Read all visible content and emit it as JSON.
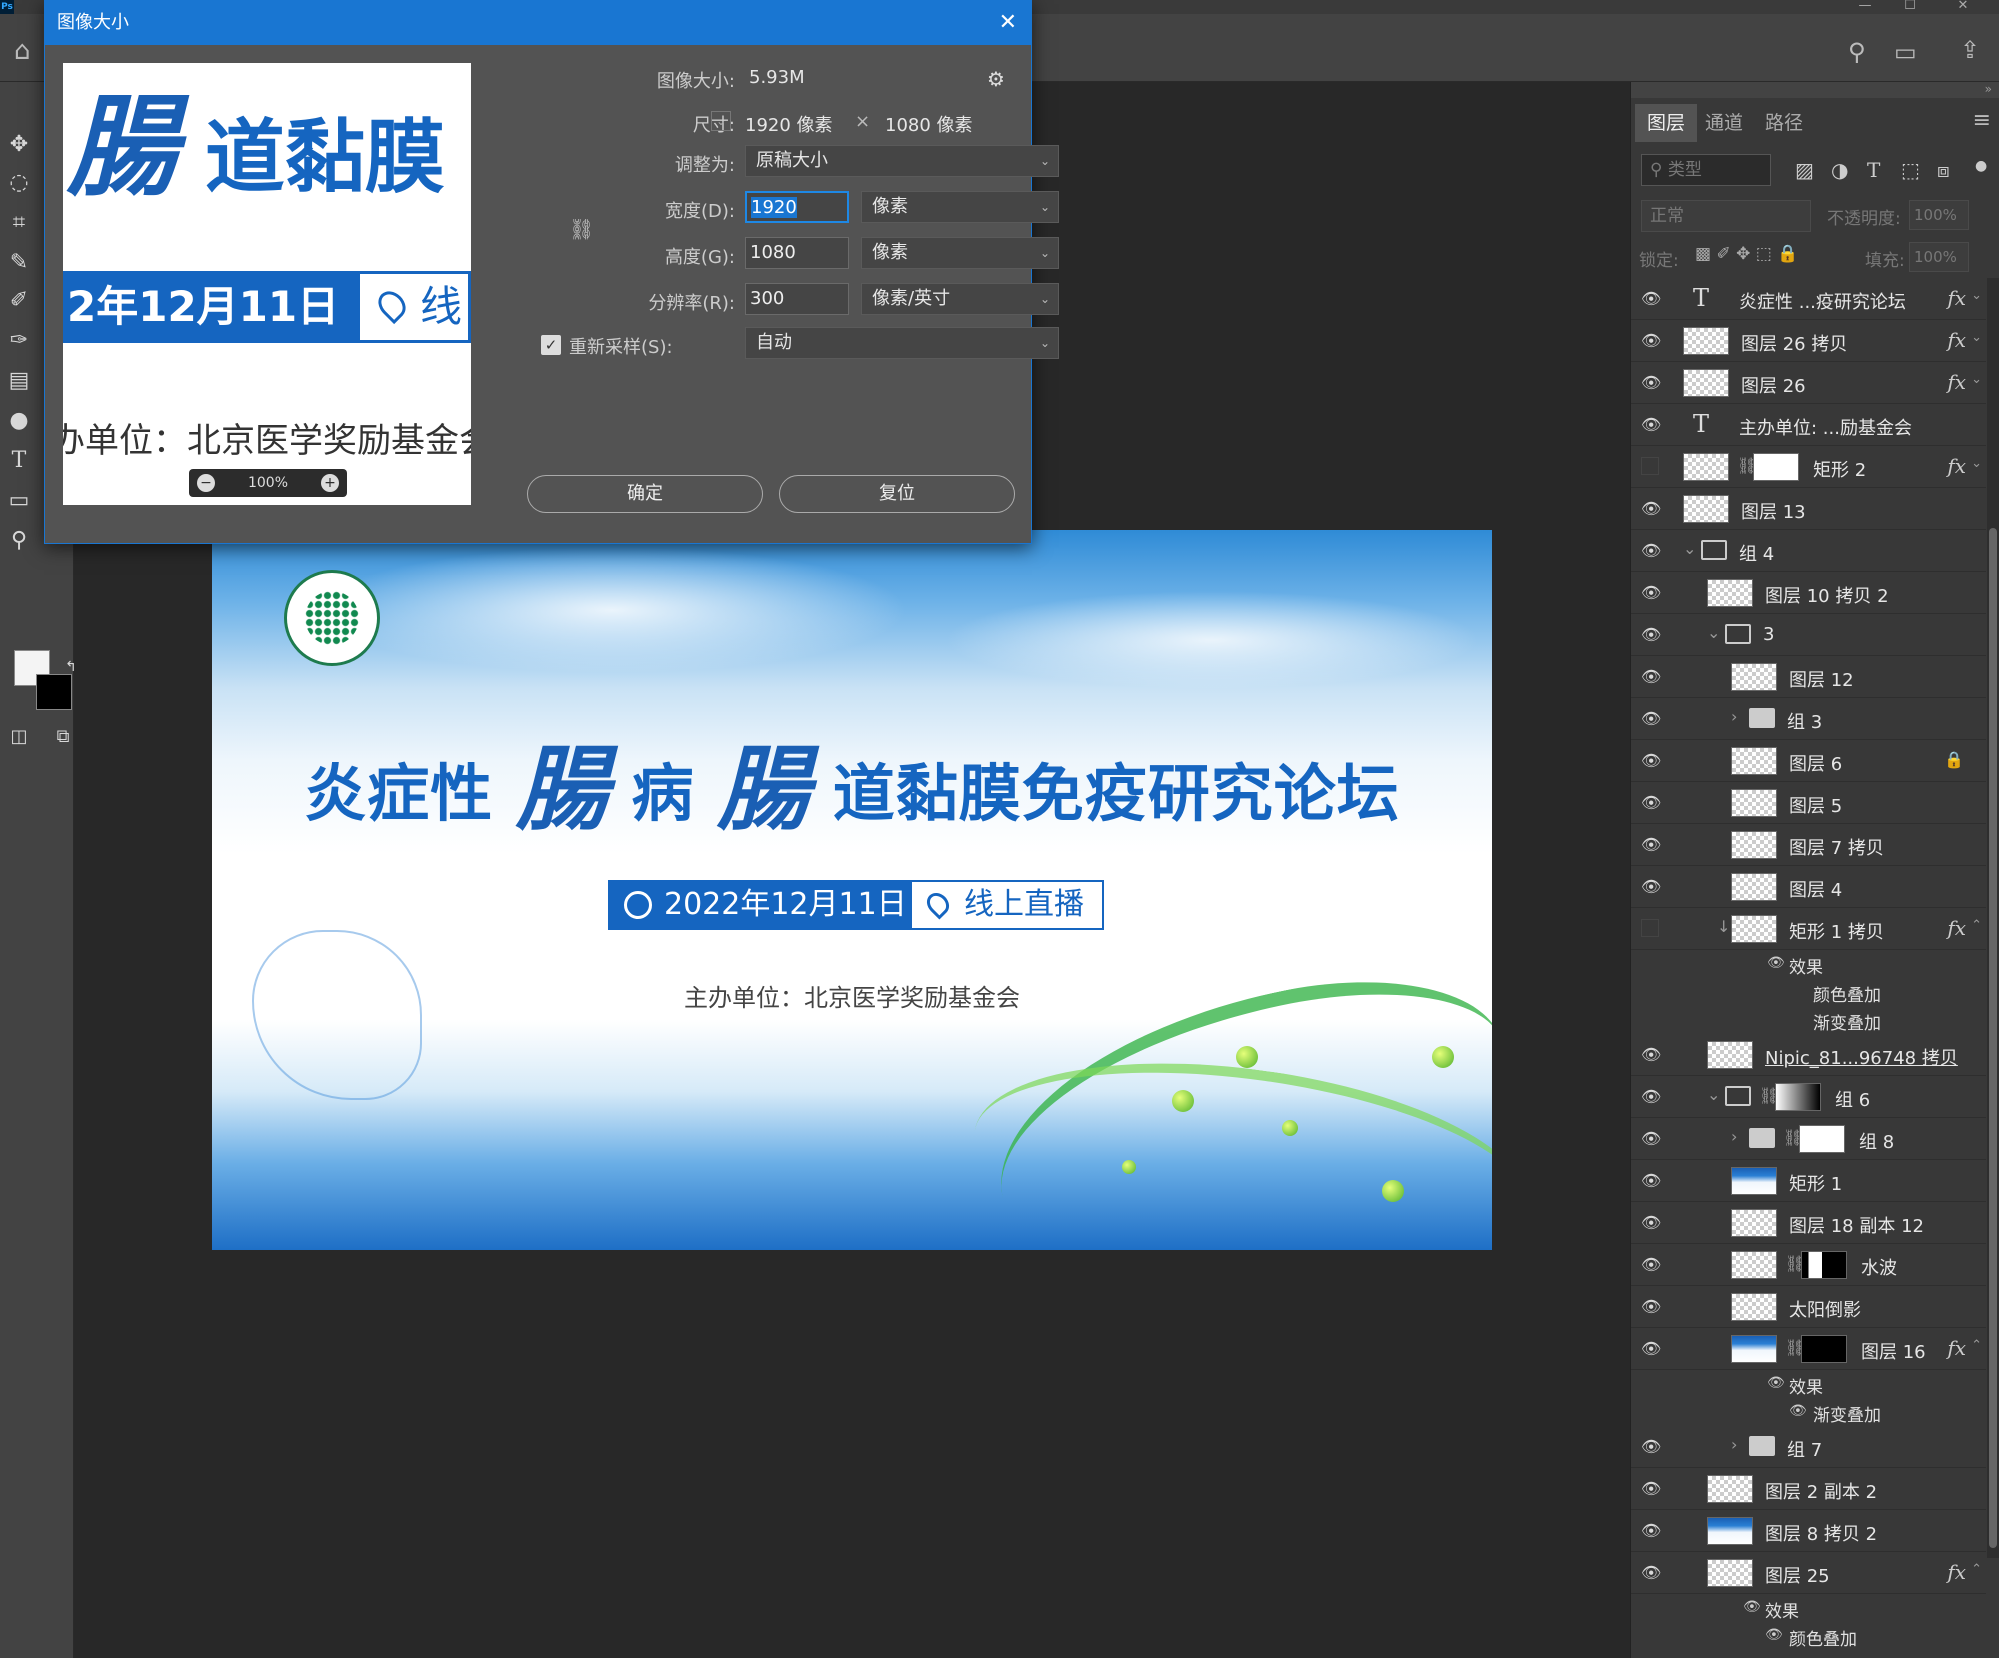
{
  "app": {
    "logo": "Ps"
  },
  "window_controls": [
    "—",
    "☐",
    "✕"
  ],
  "dialog": {
    "title": "图像大小",
    "image_size_label": "图像大小:",
    "image_size_value": "5.93M",
    "dimensions_label": "尺寸:",
    "dimensions_w": "1920 像素",
    "dimensions_x": "×",
    "dimensions_h": "1080 像素",
    "fit_label": "调整为:",
    "fit_value": "原稿大小",
    "width_label": "宽度(D):",
    "width_value": "1920",
    "width_unit": "像素",
    "height_label": "高度(G):",
    "height_value": "1080",
    "height_unit": "像素",
    "resolution_label": "分辨率(R):",
    "resolution_value": "300",
    "resolution_unit": "像素/英寸",
    "resample_label": "重新采样(S):",
    "resample_value": "自动",
    "resample_checked": true,
    "zoom": "100%",
    "ok_label": "确定",
    "reset_label": "复位",
    "preview": {
      "title_a": "腸",
      "title_b": "道黏膜",
      "date": "2年12月11日",
      "loc": "线",
      "org": "办单位：北京医学奖励基金会"
    }
  },
  "banner": {
    "title_p1": "炎症性",
    "title_cal1": "腸",
    "title_p2": "病",
    "title_cal2": "腸",
    "title_p3": "道黏膜免疫研究论坛",
    "date": "2022年12月11日",
    "location": "线上直播",
    "organizer": "主办单位：北京医学奖励基金会"
  },
  "layers_panel": {
    "tabs": [
      "图层",
      "通道",
      "路径"
    ],
    "filter_placeholder": "类型",
    "blend_mode": "正常",
    "opacity_label": "不透明度:",
    "opacity_value": "100%",
    "lock_label": "锁定:",
    "fill_label": "填充:",
    "fill_value": "100%",
    "layers": [
      {
        "name": "炎症性 ...疫研究论坛",
        "kind": "text",
        "indent": 0,
        "fx": true
      },
      {
        "name": "图层 26 拷贝",
        "kind": "smart",
        "indent": 0,
        "fx": true
      },
      {
        "name": "图层 26",
        "kind": "smart",
        "indent": 0,
        "fx": true
      },
      {
        "name": "主办单位: ...励基金会",
        "kind": "text",
        "indent": 0
      },
      {
        "name": "矩形 2",
        "kind": "shape-mask",
        "indent": 0,
        "fx": true,
        "hidden": true
      },
      {
        "name": "图层 13",
        "kind": "smart",
        "indent": 0
      },
      {
        "name": "组 4",
        "kind": "group-open",
        "indent": 0
      },
      {
        "name": "图层 10 拷贝 2",
        "kind": "pixel",
        "indent": 1
      },
      {
        "name": "3",
        "kind": "group-open",
        "indent": 1
      },
      {
        "name": "图层 12",
        "kind": "pixel",
        "indent": 2
      },
      {
        "name": "组 3",
        "kind": "group-closed",
        "indent": 2
      },
      {
        "name": "图层 6",
        "kind": "pixel",
        "indent": 2,
        "locked": true
      },
      {
        "name": "图层 5",
        "kind": "pixel",
        "indent": 2
      },
      {
        "name": "图层 7 拷贝",
        "kind": "pixel",
        "indent": 2
      },
      {
        "name": "图层 4",
        "kind": "pixel",
        "indent": 2
      },
      {
        "name": "矩形 1 拷贝",
        "kind": "smart",
        "indent": 2,
        "fx": true,
        "hidden": true,
        "clip": true,
        "effects": [
          "颜色叠加",
          "渐变叠加"
        ]
      },
      {
        "name": "Nipic_81...96748 拷贝",
        "kind": "smart",
        "indent": 1,
        "link": true
      },
      {
        "name": "组 6",
        "kind": "group-open-mask",
        "indent": 1
      },
      {
        "name": "组 8",
        "kind": "group-closed-mask",
        "indent": 2
      },
      {
        "name": "矩形 1",
        "kind": "smart-blue",
        "indent": 2
      },
      {
        "name": "图层 18 副本 12",
        "kind": "pixel",
        "indent": 2
      },
      {
        "name": "水波",
        "kind": "smart-mask",
        "indent": 2
      },
      {
        "name": "太阳倒影",
        "kind": "pixel",
        "indent": 2
      },
      {
        "name": "图层 16",
        "kind": "blue-mask",
        "indent": 2,
        "fx": true,
        "effects": [
          "渐变叠加"
        ]
      },
      {
        "name": "组 7",
        "kind": "group-closed",
        "indent": 2
      },
      {
        "name": "图层 2 副本 2",
        "kind": "pixel",
        "indent": 1
      },
      {
        "name": "图层 8 拷贝 2",
        "kind": "blue",
        "indent": 1
      },
      {
        "name": "图层 25",
        "kind": "pixel",
        "indent": 1,
        "fx": true,
        "effects": [
          "颜色叠加"
        ]
      }
    ],
    "effects_label": "效果"
  }
}
